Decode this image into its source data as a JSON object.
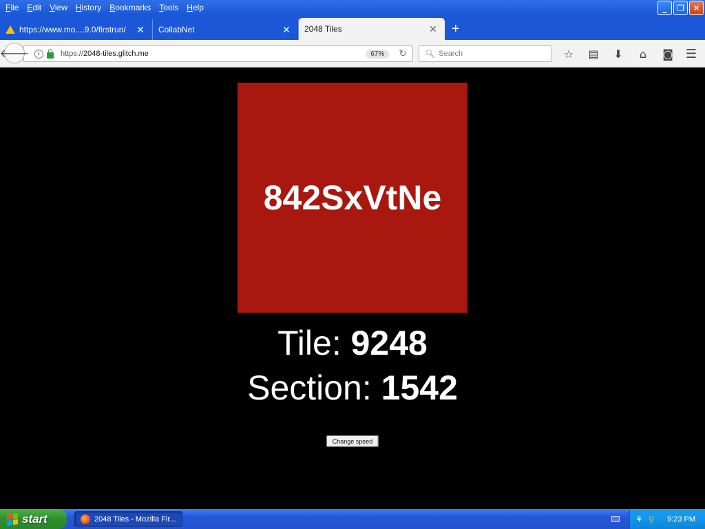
{
  "window": {
    "menu": [
      "File",
      "Edit",
      "View",
      "History",
      "Bookmarks",
      "Tools",
      "Help"
    ],
    "controls": {
      "minimize": "_",
      "restore": "❐",
      "close": "✕"
    }
  },
  "tabs": [
    {
      "label": "https://www.mo....9.0/firstrun/",
      "icon": "warning-icon",
      "close": "✕"
    },
    {
      "label": "CollabNet",
      "close": "✕"
    },
    {
      "label": "2048 Tiles",
      "close": "✕",
      "active": true
    }
  ],
  "new_tab": "+",
  "navbar": {
    "url_prefix": "https://",
    "url_host": "2048-tiles.glitch.me",
    "zoom": "67%",
    "search_placeholder": "Search"
  },
  "page": {
    "tile_text": "842SxVtNe",
    "tile_color": "#a8180f",
    "tile_label": "Tile: ",
    "tile_value": "9248",
    "section_label": "Section: ",
    "section_value": "1542",
    "speed_button": "Change speed"
  },
  "taskbar": {
    "start_label": "start",
    "task_label": "2048 Tiles - Mozilla Fir...",
    "clock": "9:23 PM"
  }
}
